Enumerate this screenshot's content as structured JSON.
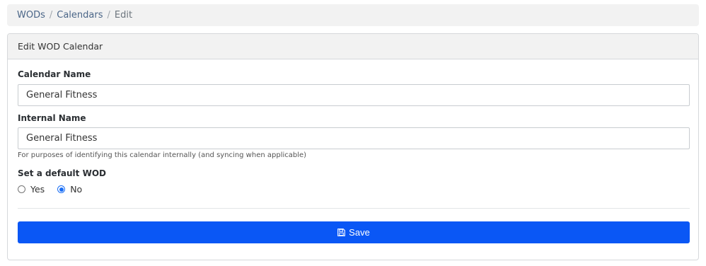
{
  "breadcrumb": {
    "items": [
      "WODs",
      "Calendars"
    ],
    "current": "Edit",
    "separator": "/"
  },
  "card": {
    "title": "Edit WOD Calendar"
  },
  "form": {
    "calendar_name_label": "Calendar Name",
    "calendar_name_value": "General Fitness",
    "internal_name_label": "Internal Name",
    "internal_name_value": "General Fitness",
    "internal_name_help": "For purposes of identifying this calendar internally (and syncing when applicable)",
    "default_wod_label": "Set a default WOD",
    "default_wod_options": [
      "Yes",
      "No"
    ],
    "default_wod_selected": "No"
  },
  "actions": {
    "save_label": "Save",
    "save_icon": "save-icon",
    "accent_color": "#0a57f5"
  }
}
